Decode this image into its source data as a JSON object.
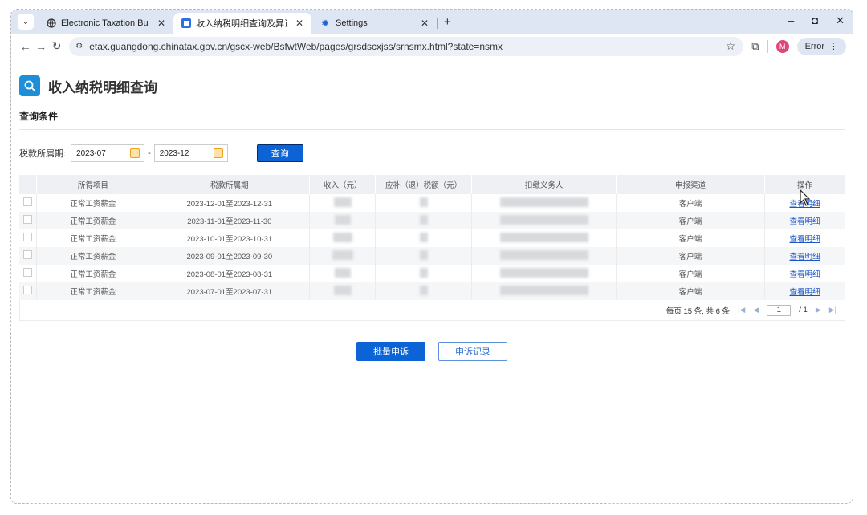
{
  "browser": {
    "tabs": [
      {
        "label": "Electronic Taxation Bureau fo",
        "icon": "globe-icon"
      },
      {
        "label": "收入纳税明细查询及异议申请",
        "icon": "tax-app-icon"
      },
      {
        "label": "Settings",
        "icon": "gear-icon"
      }
    ],
    "url": "etax.guangdong.chinatax.gov.cn/gscx-web/BsfwtWeb/pages/grsdscxjss/srnsmx.html?state=nsmx",
    "profile_initial": "M",
    "error_label": "Error"
  },
  "page": {
    "title": "收入纳税明细查询",
    "section_title": "查询条件",
    "filter": {
      "label": "税款所属期:",
      "start": "2023-07",
      "end": "2023-12",
      "separator": "-",
      "query_label": "查询"
    },
    "table": {
      "columns": [
        "所得项目",
        "税款所属期",
        "收入（元）",
        "应补（退）税额（元）",
        "扣缴义务人",
        "申报渠道",
        "操作"
      ],
      "rows": [
        {
          "item": "正常工资薪金",
          "period": "2023-12-01至2023-12-31",
          "channel": "客户端",
          "action": "查看明细"
        },
        {
          "item": "正常工资薪金",
          "period": "2023-11-01至2023-11-30",
          "channel": "客户端",
          "action": "查看明细"
        },
        {
          "item": "正常工资薪金",
          "period": "2023-10-01至2023-10-31",
          "channel": "客户端",
          "action": "查看明细"
        },
        {
          "item": "正常工资薪金",
          "period": "2023-09-01至2023-09-30",
          "channel": "客户端",
          "action": "查看明细"
        },
        {
          "item": "正常工资薪金",
          "period": "2023-08-01至2023-08-31",
          "channel": "客户端",
          "action": "查看明细"
        },
        {
          "item": "正常工资薪金",
          "period": "2023-07-01至2023-07-31",
          "channel": "客户端",
          "action": "查看明细"
        }
      ]
    },
    "pager": {
      "summary": "每页 15 条, 共 6 条",
      "current": "1",
      "total": "/ 1"
    },
    "buttons": {
      "batch_appeal": "批量申诉",
      "appeal_record": "申诉记录"
    }
  }
}
